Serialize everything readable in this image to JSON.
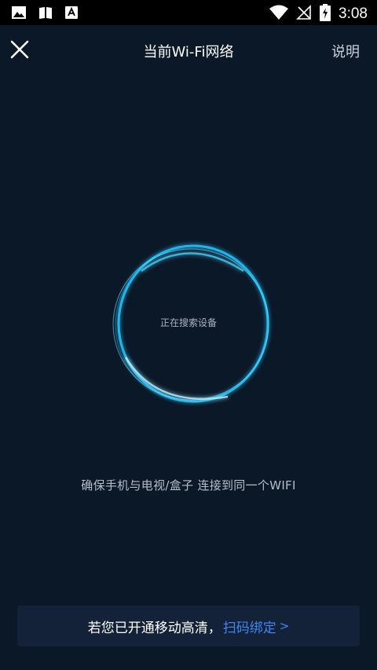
{
  "status_bar": {
    "time": "3:08",
    "icons_left": [
      "image-icon",
      "book-icon",
      "font-download-icon"
    ],
    "icons_right": [
      "wifi-icon",
      "no-signal-icon",
      "battery-charging-icon"
    ]
  },
  "header": {
    "title": "当前Wi-Fi网络",
    "help_label": "说明"
  },
  "search": {
    "status_text": "正在搜索设备"
  },
  "hint_text": "确保手机与电视/盒子 连接到同一个WIFI",
  "bottom_banner": {
    "prefix_text": "若您已开通移动高清，",
    "link_text": "扫码绑定",
    "chevron": ">"
  },
  "colors": {
    "background": "#0b1828",
    "accent_link": "#3f87f0",
    "ring_glow": "#27c7ff",
    "card_bg": "#132238"
  }
}
